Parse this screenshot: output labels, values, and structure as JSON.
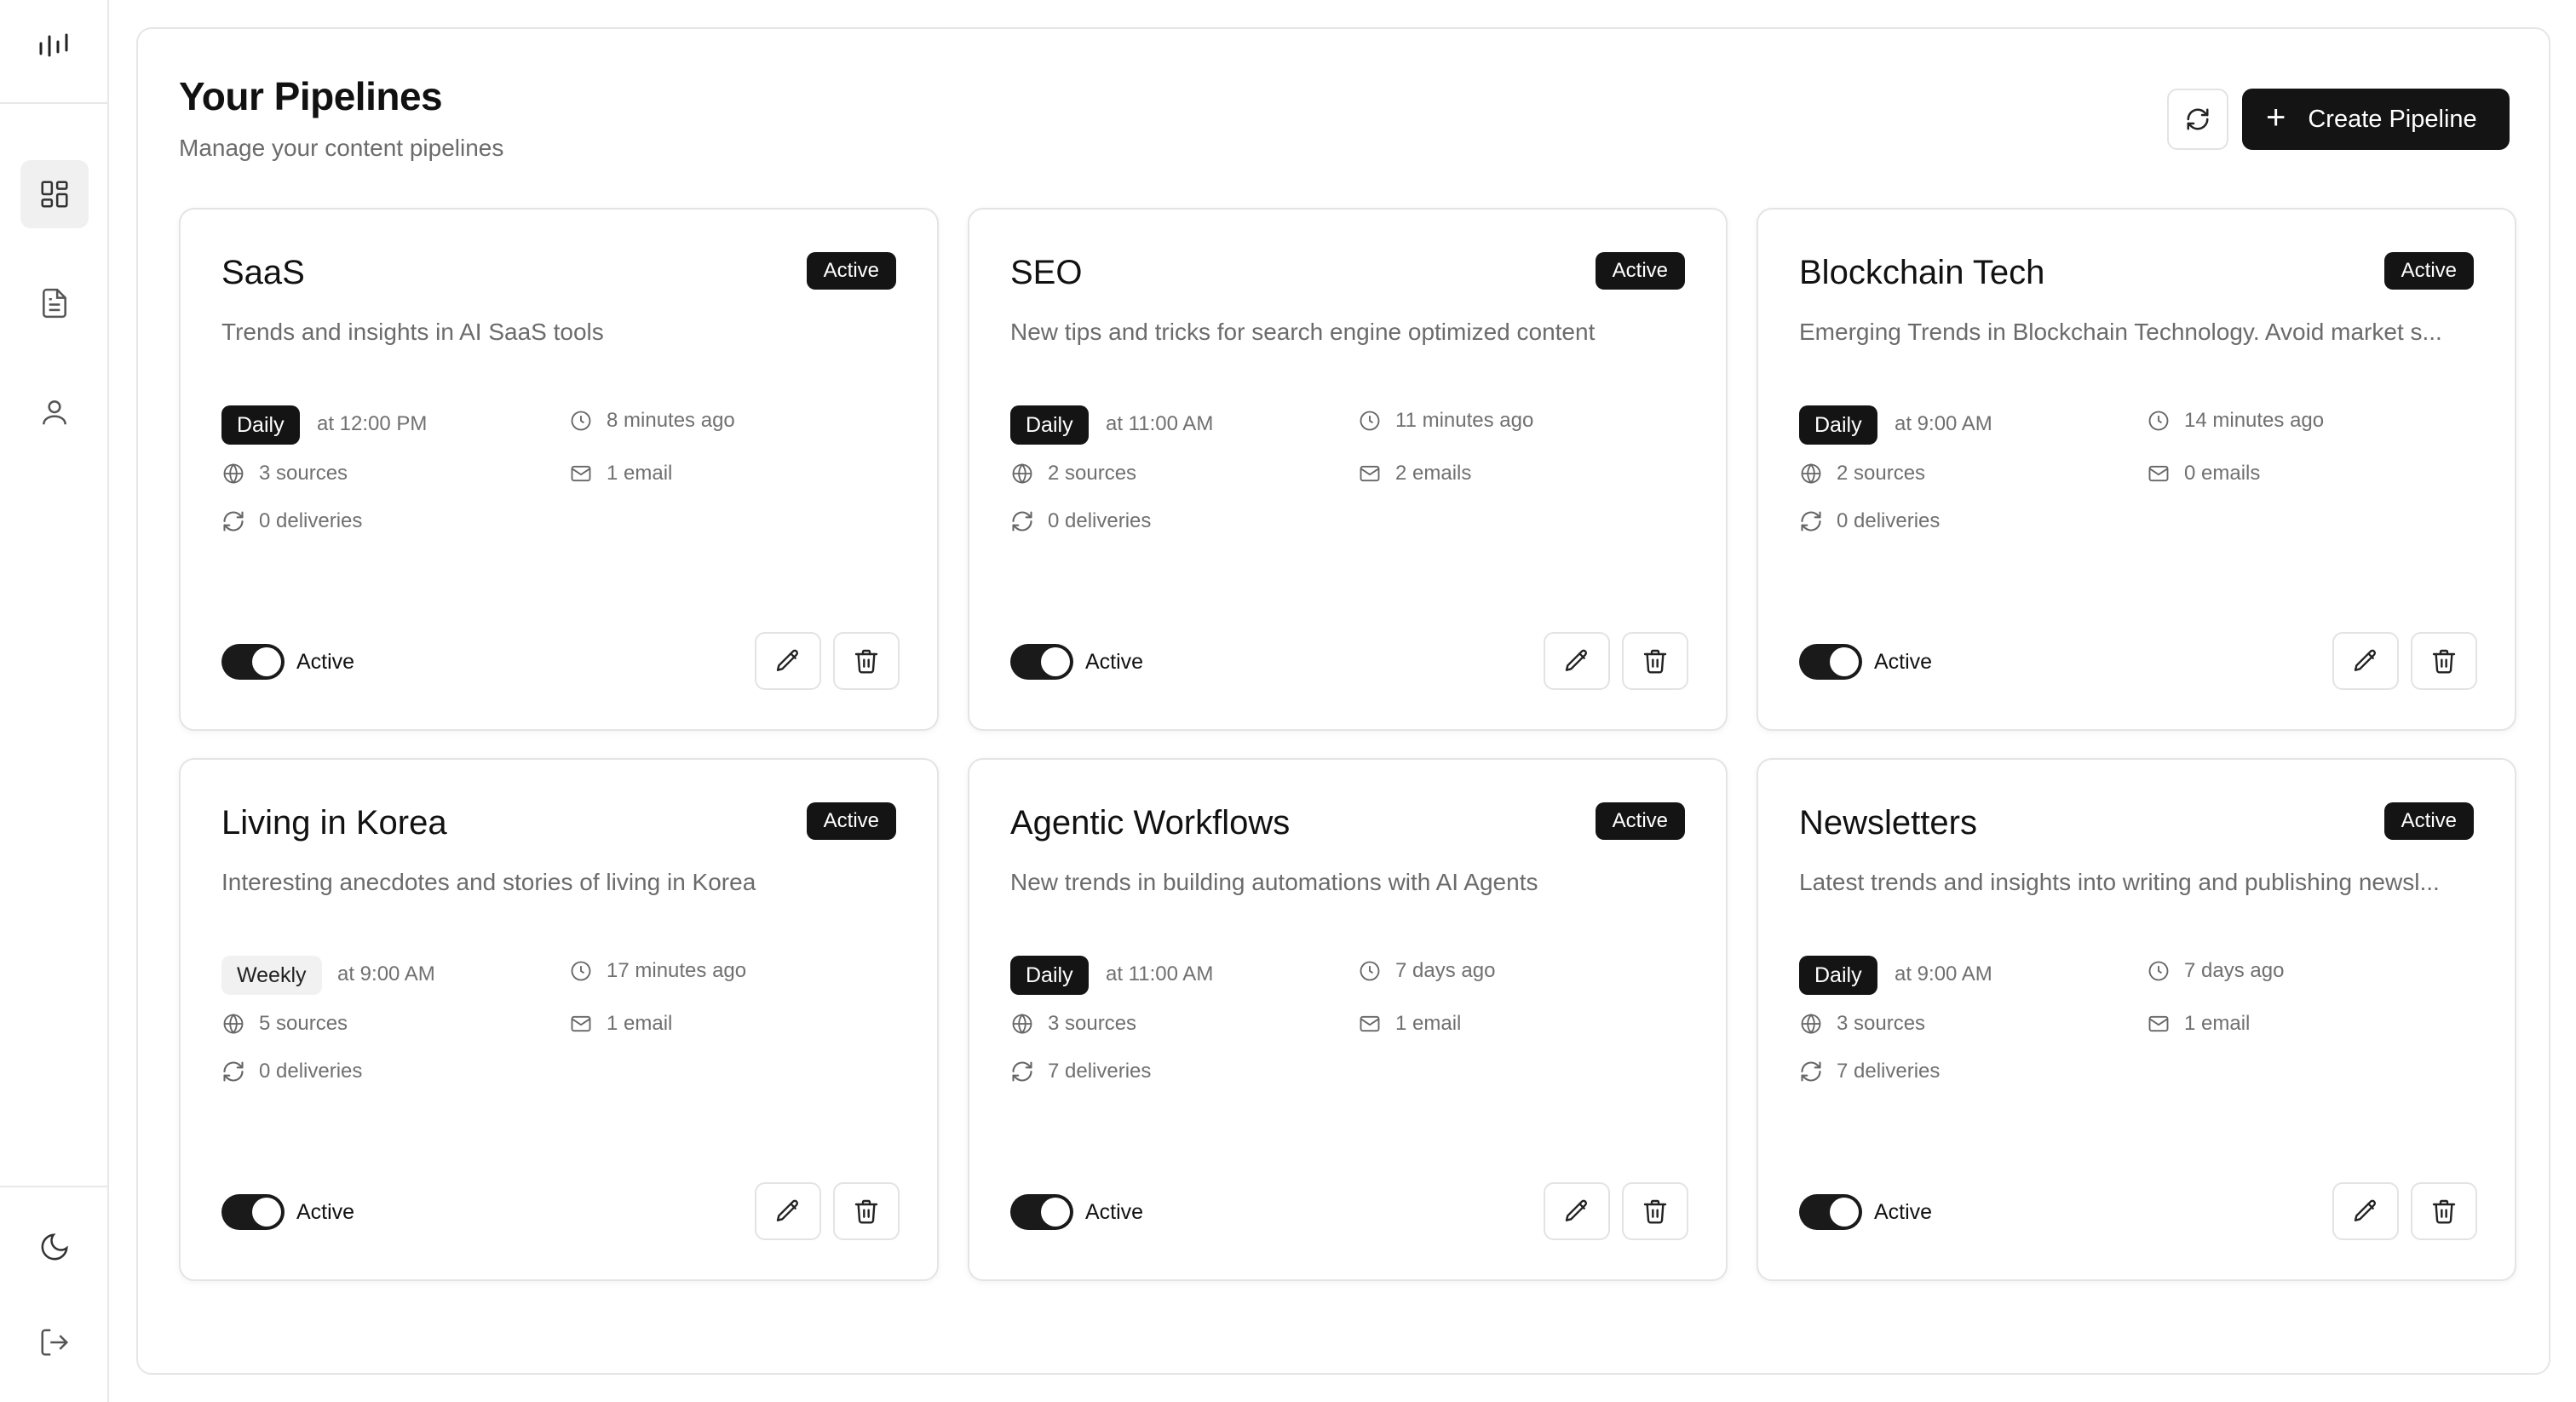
{
  "sidebar": {
    "logo_icon": "waveform-logo-icon",
    "nav": [
      {
        "icon": "dashboard-grid-icon",
        "active": true
      },
      {
        "icon": "document-icon",
        "active": false
      },
      {
        "icon": "user-icon",
        "active": false
      }
    ],
    "bottom": [
      {
        "icon": "moon-icon"
      },
      {
        "icon": "logout-icon"
      }
    ]
  },
  "header": {
    "title": "Your Pipelines",
    "subtitle": "Manage your content pipelines",
    "refresh_icon": "refresh-icon",
    "create_label": "Create Pipeline",
    "create_icon": "plus-icon"
  },
  "colors": {
    "accent_dark": "#141414",
    "muted_text": "#6b6b6b",
    "border": "#e4e4e4"
  },
  "pipelines": [
    {
      "name": "SaaS",
      "status": "Active",
      "description": "Trends and insights in AI SaaS tools",
      "frequency": "Daily",
      "time": "at 12:00 PM",
      "updated": "8 minutes ago",
      "sources": "3 sources",
      "emails": "1 email",
      "deliveries": "0 deliveries",
      "toggle_label": "Active",
      "enabled": true
    },
    {
      "name": "SEO",
      "status": "Active",
      "description": "New tips and tricks for search engine optimized content",
      "frequency": "Daily",
      "time": "at 11:00 AM",
      "updated": "11 minutes ago",
      "sources": "2 sources",
      "emails": "2 emails",
      "deliveries": "0 deliveries",
      "toggle_label": "Active",
      "enabled": true
    },
    {
      "name": "Blockchain Tech",
      "status": "Active",
      "description": "Emerging Trends in Blockchain Technology. Avoid market s...",
      "frequency": "Daily",
      "time": "at 9:00 AM",
      "updated": "14 minutes ago",
      "sources": "2 sources",
      "emails": "0 emails",
      "deliveries": "0 deliveries",
      "toggle_label": "Active",
      "enabled": true
    },
    {
      "name": "Living in Korea",
      "status": "Active",
      "description": "Interesting anecdotes and stories of living in Korea",
      "frequency": "Weekly",
      "time": "at 9:00 AM",
      "updated": "17 minutes ago",
      "sources": "5 sources",
      "emails": "1 email",
      "deliveries": "0 deliveries",
      "toggle_label": "Active",
      "enabled": true
    },
    {
      "name": "Agentic Workflows",
      "status": "Active",
      "description": "New trends in building automations with AI Agents",
      "frequency": "Daily",
      "time": "at 11:00 AM",
      "updated": "7 days ago",
      "sources": "3 sources",
      "emails": "1 email",
      "deliveries": "7 deliveries",
      "toggle_label": "Active",
      "enabled": true
    },
    {
      "name": "Newsletters",
      "status": "Active",
      "description": "Latest trends and insights into writing and publishing newsl...",
      "frequency": "Daily",
      "time": "at 9:00 AM",
      "updated": "7 days ago",
      "sources": "3 sources",
      "emails": "1 email",
      "deliveries": "7 deliveries",
      "toggle_label": "Active",
      "enabled": true
    }
  ]
}
